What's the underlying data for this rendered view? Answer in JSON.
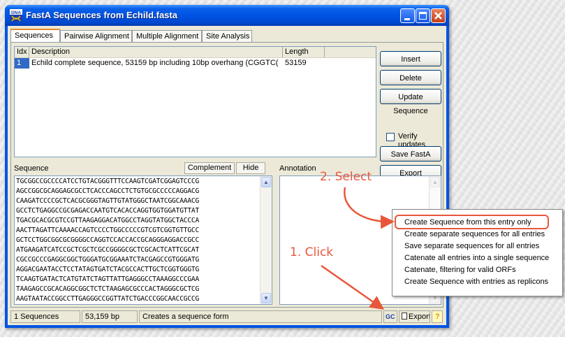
{
  "window": {
    "title": "FastA Sequences from Echild.fasta",
    "app_icon_label": "DNA"
  },
  "tabs": [
    {
      "label": "Sequences",
      "active": true
    },
    {
      "label": "Pairwise Alignment"
    },
    {
      "label": "Multiple Alignment"
    },
    {
      "label": "Site Analysis"
    }
  ],
  "list": {
    "columns": [
      "Idx",
      "Description",
      "Length"
    ],
    "rows": [
      {
        "idx": "1",
        "description": "Echild complete sequence, 53159 bp including 10bp overhang (CGGTC(",
        "length": "53159"
      }
    ]
  },
  "buttons": {
    "insert": "Insert Sequence",
    "delete": "Delete Sequence",
    "update": "Update Sequence",
    "verify": "Verify updates",
    "save": "Save FastA File",
    "export_summary": "Export Summary"
  },
  "sequence": {
    "label": "Sequence",
    "complement": "Complement",
    "hide": "Hide",
    "lines": [
      "TGCGGCCGCCCCATCCTGTACGGGTTTCCAAGTCGATCGGAGTCCCG",
      "AGCCGGCGCAGGAGCGCCTCACCCAGCCTCTGTGCGCCCCCAGGACG",
      "CAAGATCCCCGCTCACGCGGGTAGTTGTATGGGCTAATCGGCAAACG",
      "GCCTCTGAGGCCGCGAGACCAATGTCACACCAGGTGGTGGATGTTAT",
      "TGACGCACGCGTCCGTTAAGAGGACATGGCCTAGGTATGGCTACCCA",
      "AACTTAGATTCAAAACCAGTCCCCTGGCCCCCGTCGTCGGTGTTGCC",
      "GCTCCTGGCGGCGCGGGGCCAGGTCCACCACCGCAGGGAGGACCGCC",
      "ATGAAGATCATCCGCTCGCTCGCCGGGGCGCTCGCACTCATTCGCAT",
      "CGCCGCCCGAGGCGGCTGGGATGCGGAAATCTACGAGCCGTGGGATG",
      "AGGACGAATACCTCCTATAGTGATCTACGCCACTTGCTCGGTGGGTG",
      "TCAAGTGATACTCATGTATCTAGTTATTGAGGGCCTAAAGGCCCGAA",
      "TAAGAGCCGCACAGGCGGCTCTCTAAGAGCGCCCACTAGGGCGCTCG",
      "AAGTAATACCGGCCTTGAGGGCCGGTTATCTGACCCGGCAACCGCCG"
    ]
  },
  "annotation": {
    "label": "Annotation"
  },
  "status": {
    "count": "1 Sequences",
    "bp": "53,159 bp",
    "message": "Creates a sequence form",
    "gc": "GC",
    "export": "Export",
    "help": "?"
  },
  "context_menu": {
    "items": [
      "Create Sequence from this entry only",
      "Create separate sequences for all entries",
      "Save separate sequences for all entries",
      "Catenate all entries into a single sequence",
      "Catenate, filtering for valid ORFs",
      "Create Sequence with entries as replicons"
    ]
  },
  "callouts": {
    "select": "2. Select",
    "click": "1. Click",
    "color": "#e8573b"
  }
}
